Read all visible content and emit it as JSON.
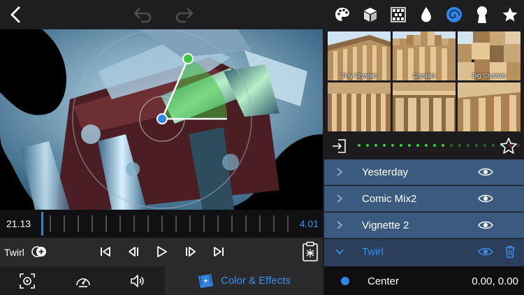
{
  "toolbar": {
    "back_icon": "chevron-left-icon",
    "undo_icon": "undo-icon",
    "redo_icon": "redo-icon",
    "tools": [
      "palette-icon",
      "cube-icon",
      "pattern-icon",
      "drop-icon",
      "swirl-icon",
      "keyhole-icon",
      "star-icon"
    ],
    "active_tool": "swirl-icon"
  },
  "timeline": {
    "start_time": "21.13",
    "end_time": "4.01"
  },
  "transport": {
    "effect_name": "Twirl",
    "buttons": [
      "skip-back-icon",
      "step-back-icon",
      "play-icon",
      "step-forward-icon",
      "skip-forward-icon"
    ],
    "clipboard_icon": "effect-clipboard-icon"
  },
  "bottombar": {
    "buttons": [
      "frame-icon",
      "speed-icon",
      "volume-icon"
    ],
    "tab_label": "Color & Effects",
    "tab_icon": "film-sparkle-icon"
  },
  "thumbnails": [
    {
      "label": "Tiny Crystals"
    },
    {
      "label": "Crystals"
    },
    {
      "label": "Big Crystals"
    },
    {
      "label": ""
    },
    {
      "label": ""
    },
    {
      "label": ""
    }
  ],
  "strength": {
    "level": 0.5,
    "dot_count": 21
  },
  "layers": [
    {
      "name": "Yesterday",
      "expanded": false
    },
    {
      "name": "Comic Mix2",
      "expanded": false
    },
    {
      "name": "Vignette 2",
      "expanded": false
    },
    {
      "name": "Twirl",
      "expanded": true
    }
  ],
  "parameter": {
    "name": "Center",
    "value": "0.00, 0.00"
  },
  "colors": {
    "accent": "#3d8fe8",
    "layer_row": "#3b5a80",
    "active_layer_row": "#2b3f5c",
    "handle_green": "#3cc63c",
    "handle_blue": "#2f86e6"
  }
}
